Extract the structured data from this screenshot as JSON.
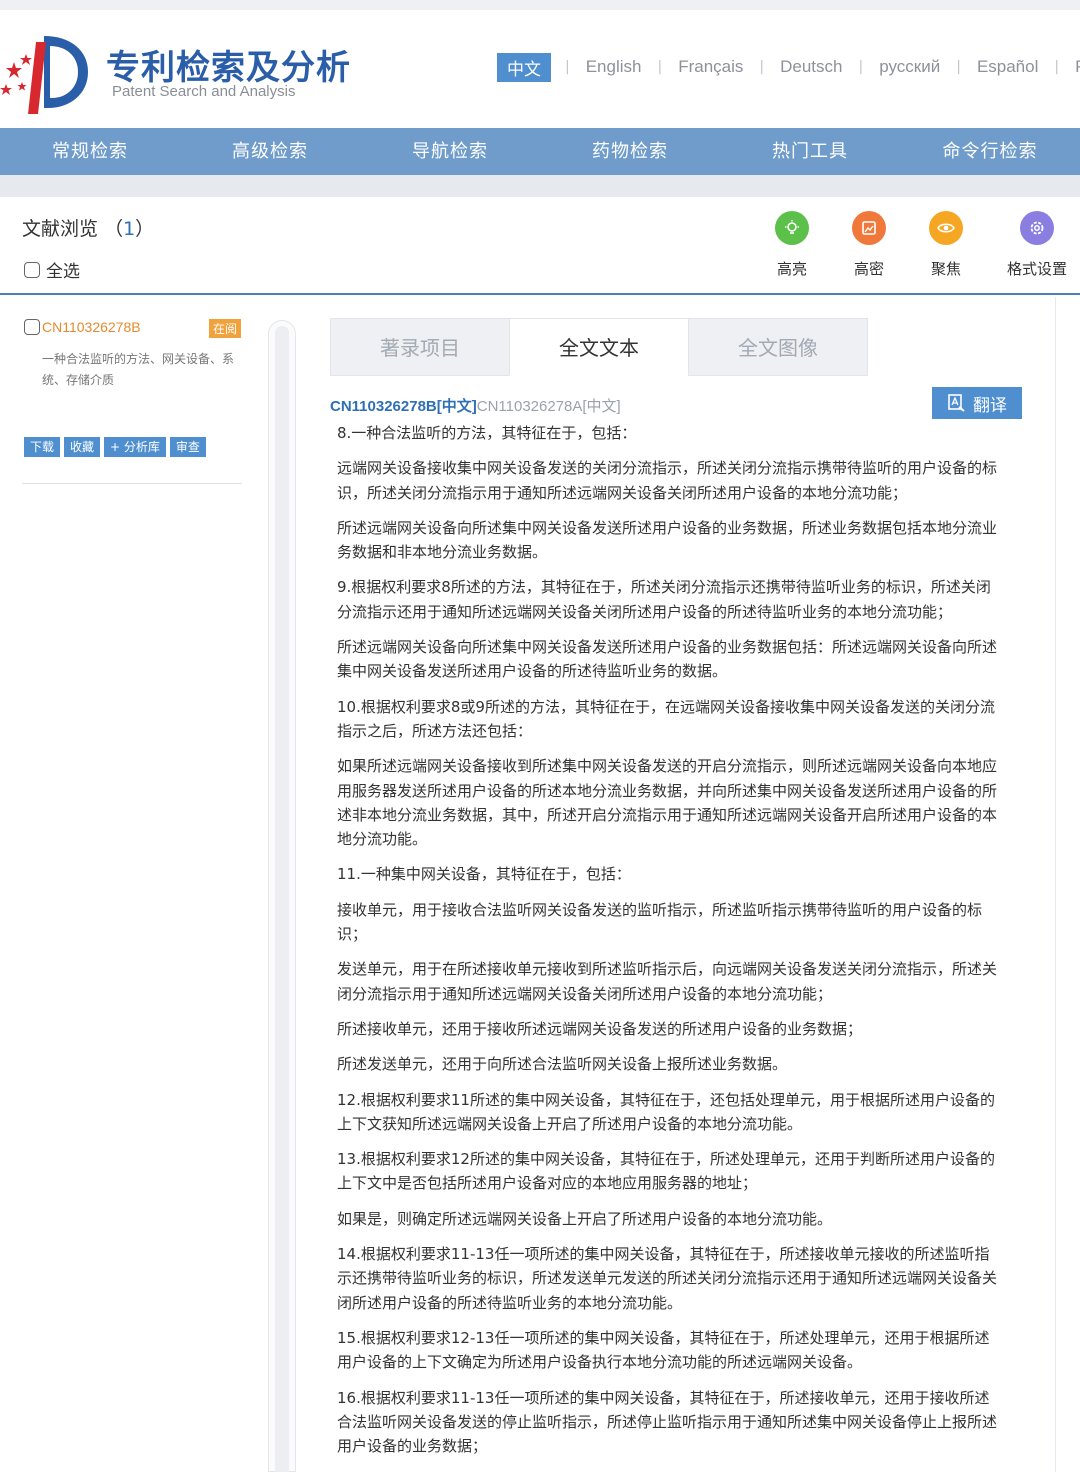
{
  "brand": {
    "title": "专利检索及分析",
    "subtitle": "Patent Search and Analysis"
  },
  "languages": [
    "中文",
    "English",
    "Français",
    "Deutsch",
    "русский",
    "Español",
    "Pe"
  ],
  "active_language": "中文",
  "nav": [
    "常规检索",
    "高级检索",
    "导航检索",
    "药物检索",
    "热门工具",
    "命令行检索"
  ],
  "toolbar": {
    "browse_title": "文献浏览",
    "browse_count": "1",
    "select_all": "全选",
    "tools": [
      {
        "label": "高亮",
        "color": "#5cc04a",
        "icon": "bulb-icon"
      },
      {
        "label": "高密",
        "color": "#f0783a",
        "icon": "image-icon"
      },
      {
        "label": "聚焦",
        "color": "#f5a623",
        "icon": "eye-icon"
      },
      {
        "label": "格式设置",
        "color": "#8a7fe0",
        "icon": "gear-icon"
      }
    ]
  },
  "doc_list": {
    "doc_id": "CN110326278B",
    "badge": "在阅",
    "description": "一种合法监听的方法、网关设备、系统、存储介质",
    "actions": [
      "下载",
      "收藏",
      "+ 分析库",
      "审查"
    ]
  },
  "tabs": [
    "著录项目",
    "全文文本",
    "全文图像"
  ],
  "active_tab": "全文文本",
  "doc_links": {
    "active": "CN110326278B[中文]",
    "other": "CN110326278A[中文]"
  },
  "translate_label": "翻译",
  "claims": [
    "8.一种合法监听的方法，其特征在于，包括：",
    "远端网关设备接收集中网关设备发送的关闭分流指示，所述关闭分流指示携带待监听的用户设备的标识，所述关闭分流指示用于通知所述远端网关设备关闭所述用户设备的本地分流功能；",
    "所述远端网关设备向所述集中网关设备发送所述用户设备的业务数据，所述业务数据包括本地分流业务数据和非本地分流业务数据。",
    "9.根据权利要求8所述的方法，其特征在于，所述关闭分流指示还携带待监听业务的标识，所述关闭分流指示还用于通知所述远端网关设备关闭所述用户设备的所述待监听业务的本地分流功能；",
    "所述远端网关设备向所述集中网关设备发送所述用户设备的业务数据包括：所述远端网关设备向所述集中网关设备发送所述用户设备的所述待监听业务的数据。",
    "10.根据权利要求8或9所述的方法，其特征在于，在远端网关设备接收集中网关设备发送的关闭分流指示之后，所述方法还包括：",
    "如果所述远端网关设备接收到所述集中网关设备发送的开启分流指示，则所述远端网关设备向本地应用服务器发送所述用户设备的所述本地分流业务数据，并向所述集中网关设备发送所述用户设备的所述非本地分流业务数据，其中，所述开启分流指示用于通知所述远端网关设备开启所述用户设备的本地分流功能。",
    "11.一种集中网关设备，其特征在于，包括：",
    "接收单元，用于接收合法监听网关设备发送的监听指示，所述监听指示携带待监听的用户设备的标识；",
    "发送单元，用于在所述接收单元接收到所述监听指示后，向远端网关设备发送关闭分流指示，所述关闭分流指示用于通知所述远端网关设备关闭所述用户设备的本地分流功能；",
    "所述接收单元，还用于接收所述远端网关设备发送的所述用户设备的业务数据；",
    "所述发送单元，还用于向所述合法监听网关设备上报所述业务数据。",
    "12.根据权利要求11所述的集中网关设备，其特征在于，还包括处理单元，用于根据所述用户设备的上下文获知所述远端网关设备上开启了所述用户设备的本地分流功能。",
    "13.根据权利要求12所述的集中网关设备，其特征在于，所述处理单元，还用于判断所述用户设备的上下文中是否包括所述用户设备对应的本地应用服务器的地址；",
    "如果是，则确定所述远端网关设备上开启了所述用户设备的本地分流功能。",
    "14.根据权利要求11-13任一项所述的集中网关设备，其特征在于，所述接收单元接收的所述监听指示还携带待监听业务的标识，所述发送单元发送的所述关闭分流指示还用于通知所述远端网关设备关闭所述用户设备的所述待监听业务的本地分流功能。",
    "15.根据权利要求12-13任一项所述的集中网关设备，其特征在于，所述处理单元，还用于根据所述用户设备的上下文确定为所述用户设备执行本地分流功能的所述远端网关设备。",
    "16.根据权利要求11-13任一项所述的集中网关设备，其特征在于，所述接收单元，还用于接收所述合法监听网关设备发送的停止监听指示，所述停止监听指示用于通知所述集中网关设备停止上报所述用户设备的业务数据；"
  ]
}
